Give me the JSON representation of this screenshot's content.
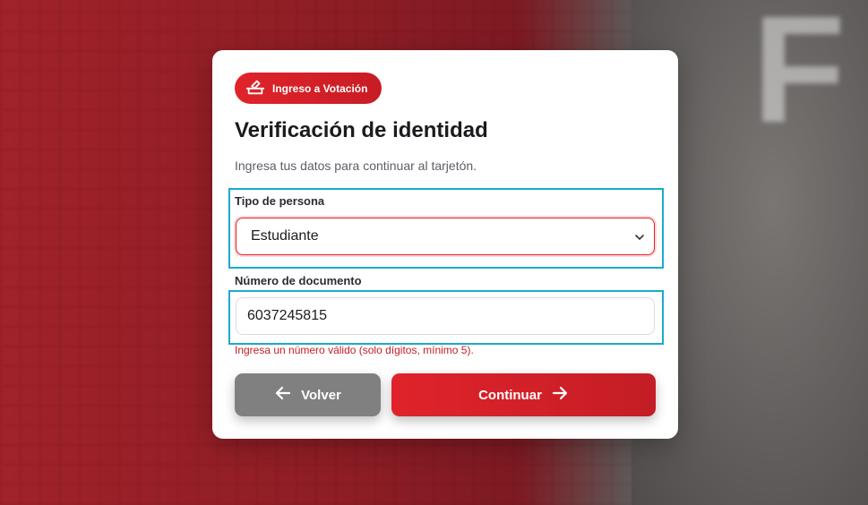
{
  "badge": {
    "label": "Ingreso a Votación",
    "icon": "ballot-box-icon"
  },
  "title": "Verificación de identidad",
  "subtitle": "Ingresa tus datos para continuar al tarjetón.",
  "person_type": {
    "label": "Tipo de persona",
    "selected": "Estudiante"
  },
  "document": {
    "label": "Número de documento",
    "value": "6037245815",
    "error": "Ingresa un número válido (solo dígitos, mínimo 5)."
  },
  "buttons": {
    "back_label": "Volver",
    "next_label": "Continuar"
  },
  "colors": {
    "accent": "#e0232b",
    "highlight": "#1ba9cf",
    "back_button": "#808080"
  }
}
